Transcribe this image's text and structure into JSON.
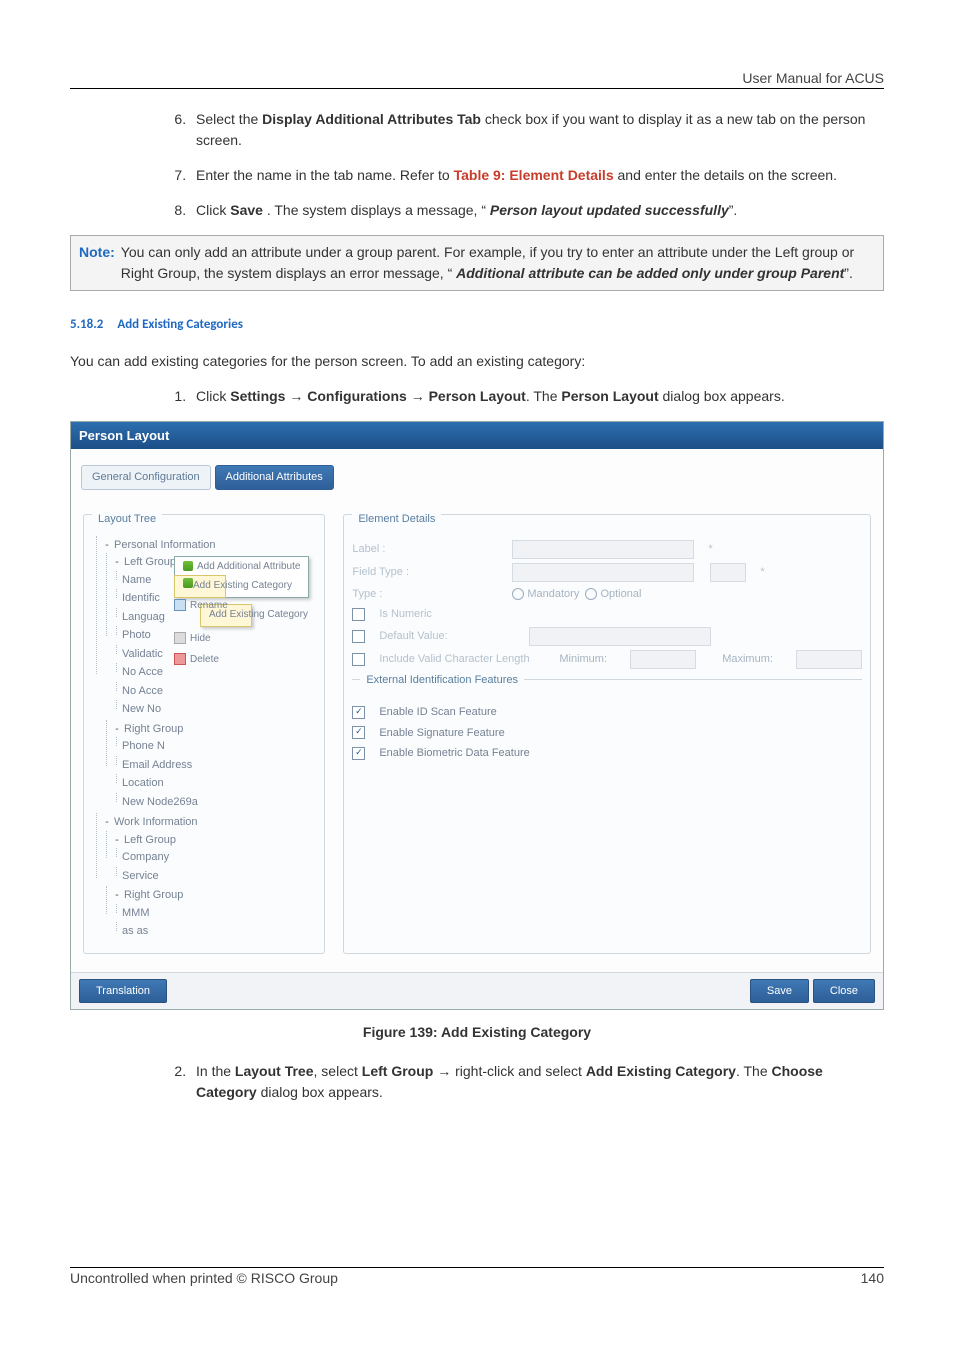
{
  "header": {
    "title": "User Manual for ACUS"
  },
  "steps1": {
    "s6": {
      "a": "Select the ",
      "b": "Display Additional Attributes Tab",
      "c": " check box if you want to display it as a new tab on the person screen."
    },
    "s7": {
      "a": "Enter the name in the tab name. Refer to ",
      "b": "Table 9: Element Details",
      "c": " and enter the details on the screen."
    },
    "s8": {
      "a": "Click ",
      "b": "Save",
      "c": ". The system displays a message, “",
      "d": "Person layout updated successfully",
      "e": "”."
    }
  },
  "note": {
    "label": "Note:",
    "line1": "You can only add an attribute under a group parent. For example, if you try to enter an attribute under the Left group or Right Group, the system displays an error message, “",
    "emph": "Additional attribute can be added only under group Parent",
    "end": "”."
  },
  "section": {
    "num": "5.18.2",
    "title": "Add Existing Categories",
    "intro": "You can add existing categories for the person screen. To add an existing category:"
  },
  "steps2": {
    "s1": {
      "a": "Click ",
      "b": "Settings",
      "ar1": " → ",
      "c": "Configurations",
      "ar2": " → ",
      "d": "Person Layout",
      "e": ". The ",
      "f": "Person Layout",
      "g": " dialog box appears."
    },
    "s2": {
      "a": "In the ",
      "b": "Layout Tree",
      "c": ", select ",
      "d": "Left Group",
      "ar": " → ",
      "e": "right-click and select ",
      "f": "Add Existing Category",
      "g": ". The ",
      "h": "Choose Category",
      "i": " dialog box appears."
    }
  },
  "shot": {
    "title": "Person Layout",
    "tabs": [
      "General Configuration",
      "Additional Attributes"
    ],
    "treeTitle": "Layout Tree",
    "tree": [
      "Personal Information",
      "Left Group",
      "Name",
      "Identific",
      "Languag",
      "Photo",
      "Validatic",
      "No Acce",
      "No Acce",
      "New No",
      "Right Group",
      "Phone N",
      "Email Address",
      "Location",
      "New Node269a",
      "Work Information",
      "Left Group",
      "Company",
      "Service",
      "Right Group",
      "MMM",
      "as as"
    ],
    "ctx1": [
      "Add Additional Attribute",
      "Add Existing Category"
    ],
    "ctx2": [
      "Add Existing Category"
    ],
    "ctx3": [
      "Rename",
      "Hide",
      "Delete"
    ],
    "detailsTitle": "Element Details",
    "fields": {
      "label": "Label :",
      "fieldType": "Field Type :",
      "type": "Type :",
      "mandatory": "Mandatory",
      "optional": "Optional",
      "isNumeric": "Is Numeric",
      "defaultValue": "Default Value:",
      "includeLen": "Include Valid Character Length",
      "min": "Minimum:",
      "max": "Maximum:"
    },
    "extTitle": "External Identification Features",
    "ext": [
      "Enable ID Scan Feature",
      "Enable Signature Feature",
      "Enable Biometric Data Feature"
    ],
    "buttons": [
      "Translation",
      "Save",
      "Close"
    ]
  },
  "figure": {
    "caption": "Figure 139: Add Existing Category"
  },
  "footer": {
    "left": "Uncontrolled when printed © RISCO Group",
    "page": "140"
  }
}
